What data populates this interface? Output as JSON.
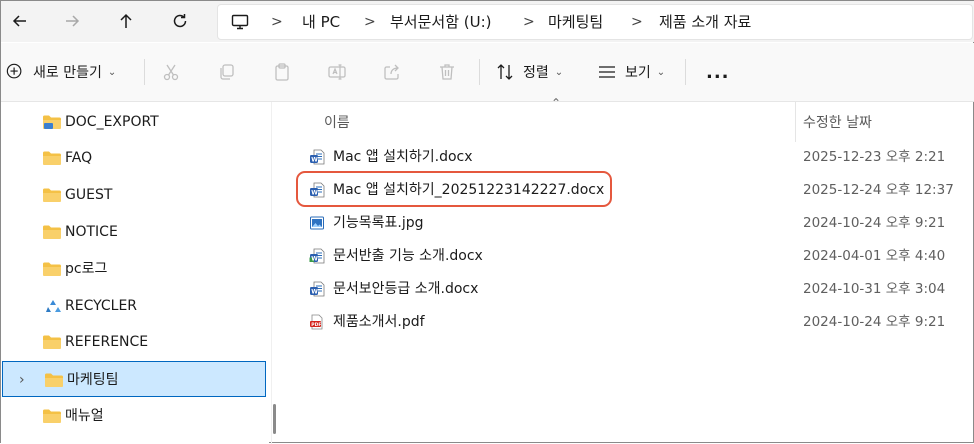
{
  "address": {
    "crumbs": [
      "내 PC",
      "부서문서함 (U:)",
      "마케팅팀",
      "제품 소개 자료"
    ],
    "separator": ">"
  },
  "toolbar": {
    "new_label": "새로 만들기",
    "sort_label": "정렬",
    "view_label": "보기",
    "more_label": "..."
  },
  "nav": {
    "items": [
      {
        "label": "DOC_EXPORT",
        "icon": "folder-shared-icon"
      },
      {
        "label": "FAQ",
        "icon": "folder-icon"
      },
      {
        "label": "GUEST",
        "icon": "folder-icon"
      },
      {
        "label": "NOTICE",
        "icon": "folder-icon"
      },
      {
        "label": "pc로그",
        "icon": "folder-icon"
      },
      {
        "label": "RECYCLER",
        "icon": "recycle-bin-icon"
      },
      {
        "label": "REFERENCE",
        "icon": "folder-icon"
      },
      {
        "label": "마케팅팀",
        "icon": "folder-icon",
        "selected": true
      },
      {
        "label": "매뉴얼",
        "icon": "folder-icon"
      }
    ]
  },
  "columns": {
    "name": "이름",
    "date": "수정한 날짜"
  },
  "files": [
    {
      "name": "Mac 앱 설치하기.docx",
      "date": "2025-12-23 오후 2:21",
      "type": "docx"
    },
    {
      "name": "Mac 앱 설치하기_20251223142227.docx",
      "date": "2025-12-24 오후 12:37",
      "type": "docx"
    },
    {
      "name": "기능목록표.jpg",
      "date": "2024-10-24 오후 9:21",
      "type": "jpg"
    },
    {
      "name": "문서반출 기능 소개.docx",
      "date": "2024-04-01 오후 4:40",
      "type": "docx-shared"
    },
    {
      "name": "문서보안등급 소개.docx",
      "date": "2024-10-31 오후 3:04",
      "type": "docx"
    },
    {
      "name": "제품소개서.pdf",
      "date": "2024-10-24 오후 9:21",
      "type": "pdf"
    }
  ],
  "colors": {
    "selection_bg": "#cce8ff",
    "selection_border": "#0067c0",
    "highlight": "#e5583e",
    "folder": "#f4c146"
  }
}
